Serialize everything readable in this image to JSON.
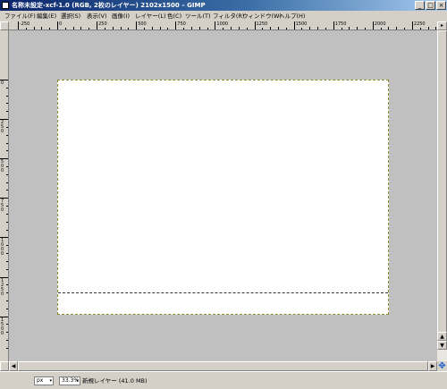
{
  "window": {
    "title": "名称未設定-xcf-1.0 (RGB, 2枚のレイヤー) 2102x1500 – GIMP",
    "minimize": "_",
    "maximize": "□",
    "close": "×"
  },
  "menu": {
    "items": [
      "ファイル(F)",
      "編集(E)",
      "選択(S)",
      "表示(V)",
      "画像(I)",
      "レイヤー(L)",
      "色(C)",
      "ツール(T)",
      "フィルタ(R)",
      "ウィンドウ(W)",
      "ヘルプ(H)"
    ]
  },
  "ruler": {
    "h_labels": [
      "-250",
      "0",
      "250",
      "500",
      "750",
      "1000",
      "1250",
      "1500",
      "1750",
      "2000",
      "2250"
    ],
    "v_labels": [
      "0",
      "250",
      "500",
      "750",
      "1000",
      "1250",
      "1500"
    ]
  },
  "nav_button": "▸",
  "scroll": {
    "up": "▲",
    "down": "▼",
    "left": "◀",
    "right": "▶"
  },
  "navigate_icon": "✥",
  "status": {
    "unit": "px",
    "zoom": "33.3%",
    "dropdown_arrow": "▾",
    "text": "新規レイヤー (41.0 MB)"
  },
  "colors": {
    "canvas_bg": "#c0c0c0",
    "image_bg": "#ffffff",
    "title_bar": "#0a246a"
  }
}
